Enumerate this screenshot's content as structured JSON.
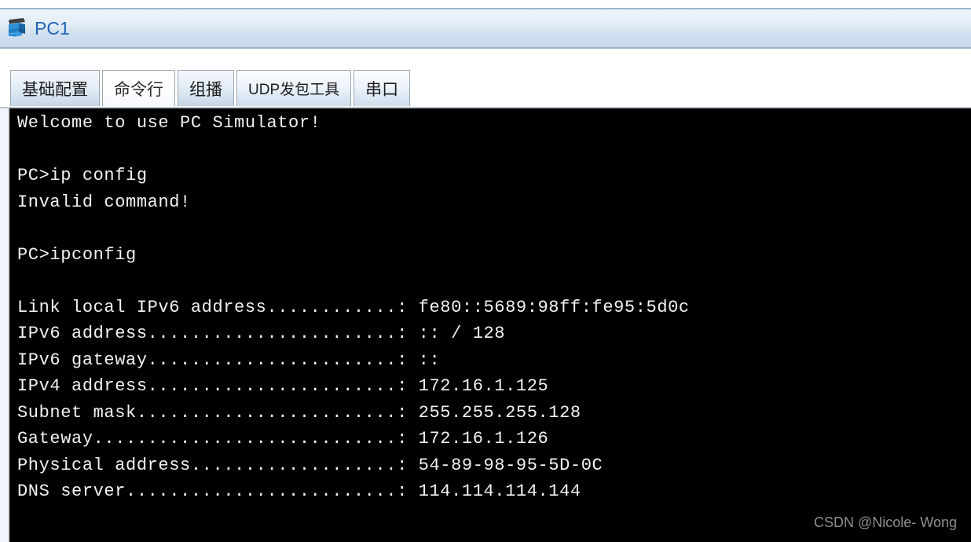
{
  "window": {
    "title": "PC1",
    "icon": "pc-device-icon"
  },
  "tabs": [
    {
      "label": "基础配置",
      "state": "selected"
    },
    {
      "label": "命令行",
      "state": "active"
    },
    {
      "label": "组播",
      "state": "normal"
    },
    {
      "label": "UDP发包工具",
      "state": "normal"
    },
    {
      "label": "串口",
      "state": "normal"
    }
  ],
  "terminal": {
    "background": "#000000",
    "foreground": "#f2f2f2",
    "lines": [
      "Welcome to use PC Simulator!",
      "",
      "PC>ip config",
      "Invalid command!",
      "",
      "PC>ipconfig",
      "",
      "Link local IPv6 address............: fe80::5689:98ff:fe95:5d0c",
      "IPv6 address.......................: :: / 128",
      "IPv6 gateway.......................: ::",
      "IPv4 address.......................: 172.16.1.125",
      "Subnet mask........................: 255.255.255.128",
      "Gateway............................: 172.16.1.126",
      "Physical address...................: 54-89-98-95-5D-0C",
      "DNS server.........................: 114.114.114.144"
    ],
    "prompt": "PC>",
    "commands": [
      "ip config",
      "ipconfig"
    ],
    "ipconfig": {
      "link_local_ipv6_address": "fe80::5689:98ff:fe95:5d0c",
      "ipv6_address": ":: / 128",
      "ipv6_gateway": "::",
      "ipv4_address": "172.16.1.125",
      "subnet_mask": "255.255.255.128",
      "gateway": "172.16.1.126",
      "physical_address": "54-89-98-95-5D-0C",
      "dns_server": "114.114.114.144"
    },
    "messages": {
      "welcome": "Welcome to use PC Simulator!",
      "invalid_command": "Invalid command!"
    }
  },
  "watermark": {
    "text": "CSDN @Nicole- Wong"
  },
  "colors": {
    "titlebar_text": "#1f63b5",
    "titlebar_border": "#9bb3c9",
    "tab_border": "#9aa6b2",
    "terminal_bg": "#000000",
    "terminal_fg": "#f2f2f2",
    "watermark": "#8e8e8e"
  }
}
